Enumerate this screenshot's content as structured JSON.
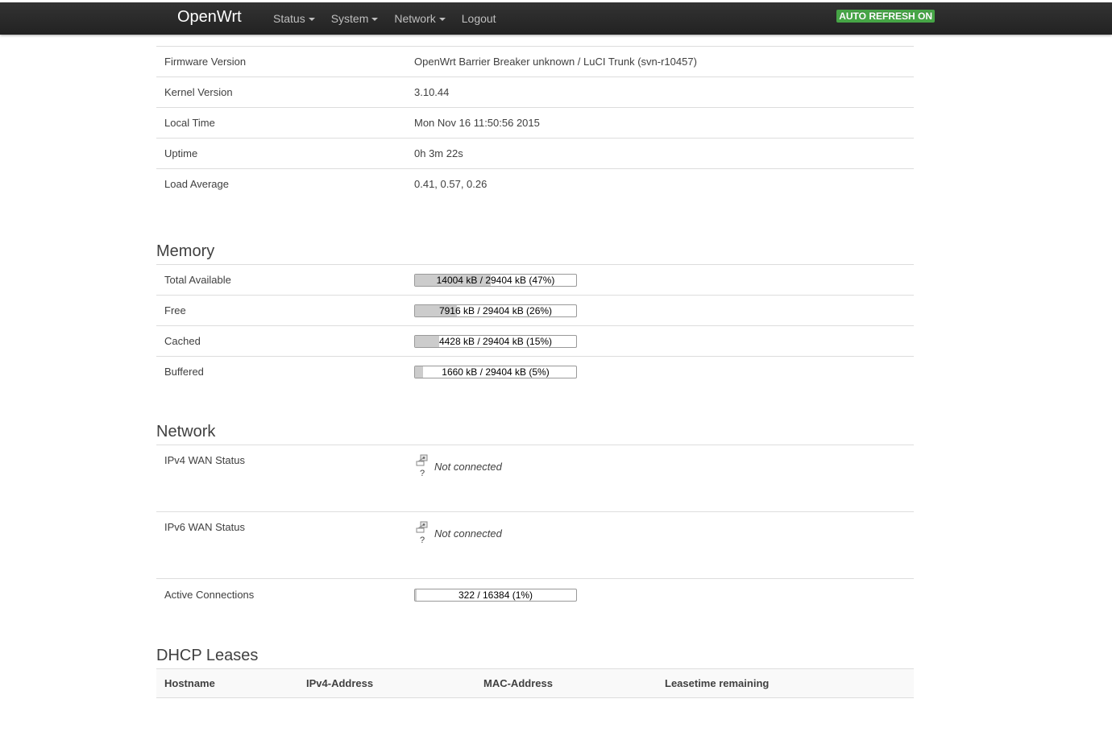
{
  "header": {
    "brand": "OpenWrt",
    "nav": [
      {
        "label": "Status",
        "dropdown": true
      },
      {
        "label": "System",
        "dropdown": true
      },
      {
        "label": "Network",
        "dropdown": true
      },
      {
        "label": "Logout",
        "dropdown": false
      }
    ],
    "auto_refresh": "AUTO REFRESH ON",
    "auto_refresh_color": "#46a546"
  },
  "system": {
    "rows": [
      {
        "label": "Firmware Version",
        "value": "OpenWrt Barrier Breaker unknown / LuCI Trunk (svn-r10457)"
      },
      {
        "label": "Kernel Version",
        "value": "3.10.44"
      },
      {
        "label": "Local Time",
        "value": "Mon Nov 16 11:50:56 2015"
      },
      {
        "label": "Uptime",
        "value": "0h 3m 22s"
      },
      {
        "label": "Load Average",
        "value": "0.41, 0.57, 0.26"
      }
    ]
  },
  "memory": {
    "title": "Memory",
    "rows": [
      {
        "label": "Total Available",
        "text": "14004 kB / 29404 kB (47%)",
        "percent": 47
      },
      {
        "label": "Free",
        "text": "7916 kB / 29404 kB (26%)",
        "percent": 26
      },
      {
        "label": "Cached",
        "text": "4428 kB / 29404 kB (15%)",
        "percent": 15
      },
      {
        "label": "Buffered",
        "text": "1660 kB / 29404 kB (5%)",
        "percent": 5
      }
    ]
  },
  "network": {
    "title": "Network",
    "ipv4": {
      "label": "IPv4 WAN Status",
      "icon": "network-unknown-icon",
      "icon_caption": "?",
      "status": "Not connected"
    },
    "ipv6": {
      "label": "IPv6 WAN Status",
      "icon": "network-unknown-icon",
      "icon_caption": "?",
      "status": "Not connected"
    },
    "connections": {
      "label": "Active Connections",
      "text": "322 / 16384 (1%)",
      "percent": 1
    }
  },
  "dhcp": {
    "title": "DHCP Leases",
    "columns": [
      "Hostname",
      "IPv4-Address",
      "MAC-Address",
      "Leasetime remaining"
    ]
  }
}
